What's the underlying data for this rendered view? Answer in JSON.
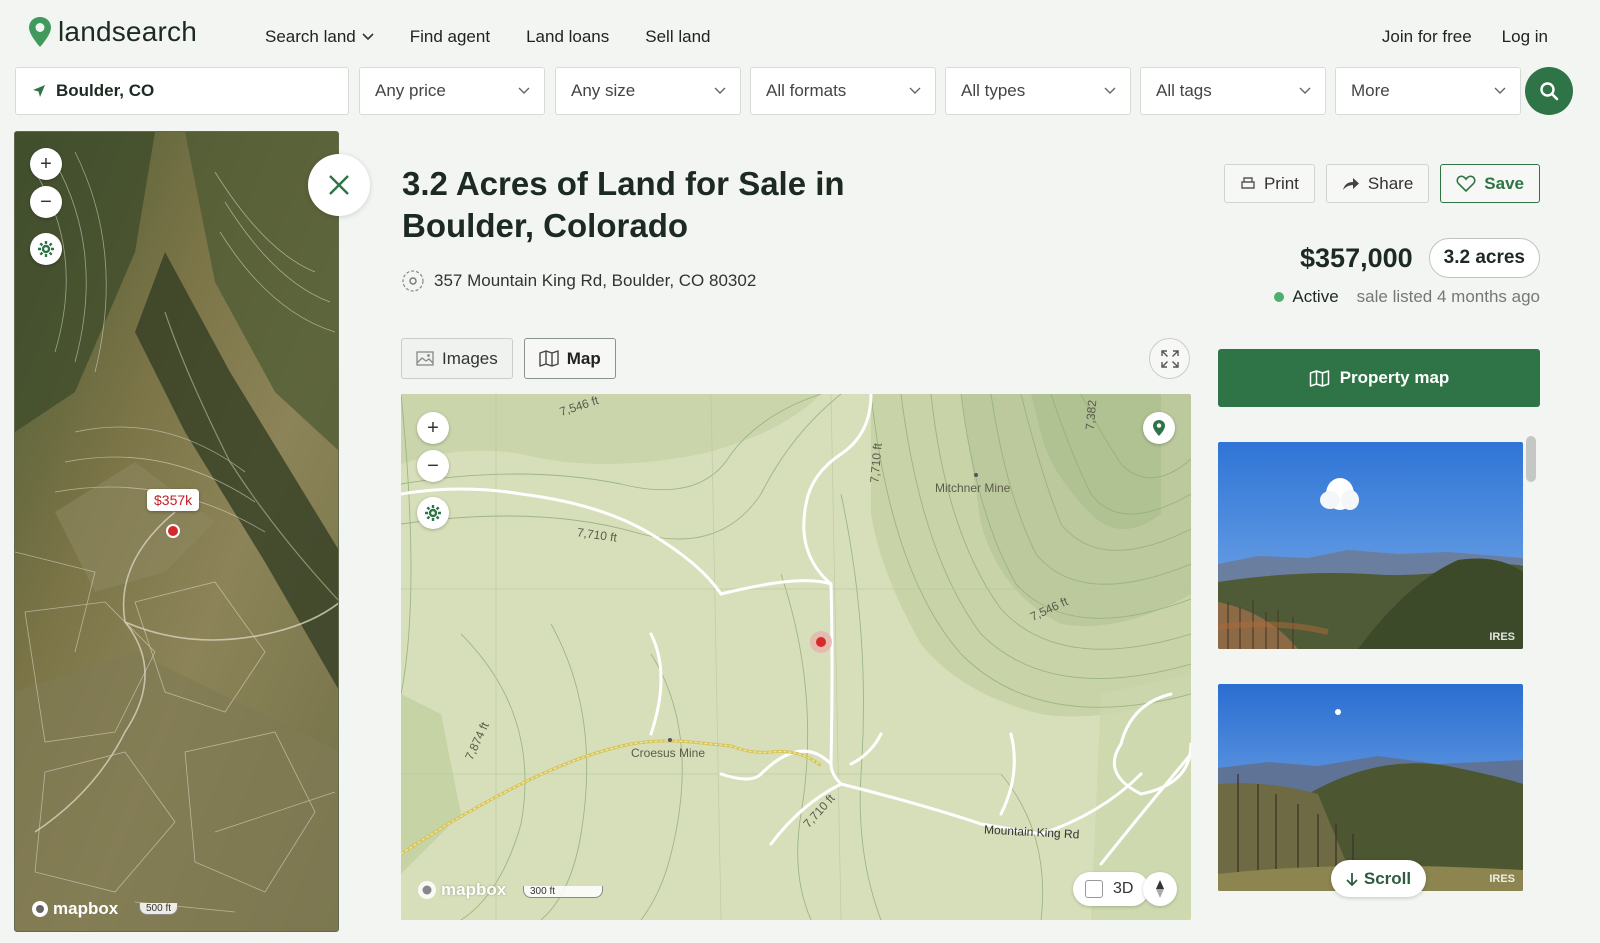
{
  "header": {
    "logo_text": "landsearch",
    "nav": [
      {
        "label": "Search land"
      },
      {
        "label": "Find agent"
      },
      {
        "label": "Land loans"
      },
      {
        "label": "Sell land"
      }
    ],
    "join_label": "Join for free",
    "login_label": "Log in"
  },
  "filters": {
    "location": "Boulder, CO",
    "price": "Any price",
    "size": "Any size",
    "formats": "All formats",
    "types": "All types",
    "tags": "All tags",
    "more": "More"
  },
  "side_map": {
    "price_pin": "$357k",
    "attribution": "mapbox",
    "scale": "500 ft"
  },
  "listing": {
    "title": "3.2 Acres of Land for Sale in Boulder, Colorado",
    "address": "357 Mountain King Rd, Boulder, CO 80302",
    "actions": {
      "print": "Print",
      "share": "Share",
      "save": "Save"
    },
    "price": "$357,000",
    "acres": "3.2 acres",
    "status": "Active",
    "listed": "sale listed 4 months ago"
  },
  "tabs": {
    "images": "Images",
    "map": "Map"
  },
  "topo_map": {
    "labels": {
      "elev1": "7,546 ft",
      "elev2": "7,710 ft",
      "elev3": "7,710 ft",
      "elev4": "7,546 ft",
      "elev5": "7,874 ft",
      "elev6": "7,710 ft",
      "elev7": "7,382",
      "mine1": "Mitchner Mine",
      "mine2": "Croesus Mine",
      "road": "Mountain King Rd"
    },
    "attribution": "mapbox",
    "scale": "300 ft",
    "toggle_3d": "3D"
  },
  "sidebar": {
    "property_map": "Property map",
    "watermark": "IRES",
    "scroll": "Scroll"
  },
  "colors": {
    "brand_green": "#2e7446",
    "pin_red": "#d42a2a",
    "active_green": "#4fae6c"
  }
}
